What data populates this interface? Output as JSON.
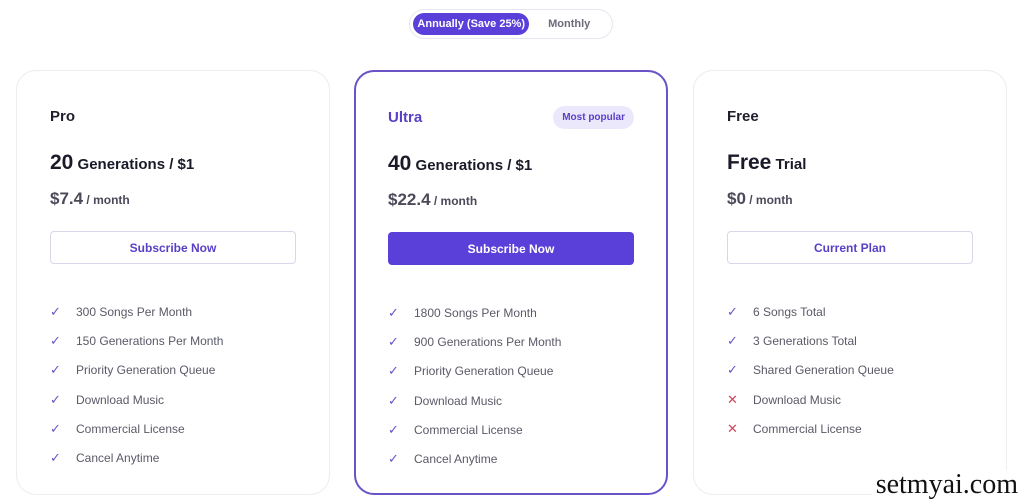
{
  "billing_toggle": {
    "options": [
      {
        "label": "Annually (Save 25%)",
        "active": true
      },
      {
        "label": "Monthly",
        "active": false
      }
    ]
  },
  "plans": [
    {
      "name": "Pro",
      "headline_big": "20",
      "headline_small": " Generations / $1",
      "price": "$7.4",
      "period": " / month",
      "cta": "Subscribe Now",
      "features": [
        {
          "text": "300 Songs Per Month",
          "included": true
        },
        {
          "text": "150 Generations Per Month",
          "included": true
        },
        {
          "text": "Priority Generation Queue",
          "included": true
        },
        {
          "text": "Download Music",
          "included": true
        },
        {
          "text": "Commercial License",
          "included": true
        },
        {
          "text": "Cancel Anytime",
          "included": true
        }
      ]
    },
    {
      "name": "Ultra",
      "badge": "Most popular",
      "headline_big": "40",
      "headline_small": " Generations / $1",
      "price": "$22.4",
      "period": " / month",
      "cta": "Subscribe Now",
      "features": [
        {
          "text": "1800 Songs Per Month",
          "included": true
        },
        {
          "text": "900 Generations Per Month",
          "included": true
        },
        {
          "text": "Priority Generation Queue",
          "included": true
        },
        {
          "text": "Download Music",
          "included": true
        },
        {
          "text": "Commercial License",
          "included": true
        },
        {
          "text": "Cancel Anytime",
          "included": true
        }
      ]
    },
    {
      "name": "Free",
      "headline_big": "Free",
      "headline_small": " Trial",
      "price": "$0",
      "period": " / month",
      "cta": "Current Plan",
      "features": [
        {
          "text": "6 Songs Total",
          "included": true
        },
        {
          "text": "3 Generations Total",
          "included": true
        },
        {
          "text": "Shared Generation Queue",
          "included": true
        },
        {
          "text": "Download Music",
          "included": false
        },
        {
          "text": "Commercial License",
          "included": false
        }
      ]
    }
  ],
  "icons": {
    "check": "✓",
    "cross": "✕"
  },
  "watermark": "setmyai.com",
  "colors": {
    "accent": "#5b3fd9",
    "accent_text": "#5a3fc7",
    "badge_bg": "#ece8fb",
    "cross": "#d0455a"
  }
}
